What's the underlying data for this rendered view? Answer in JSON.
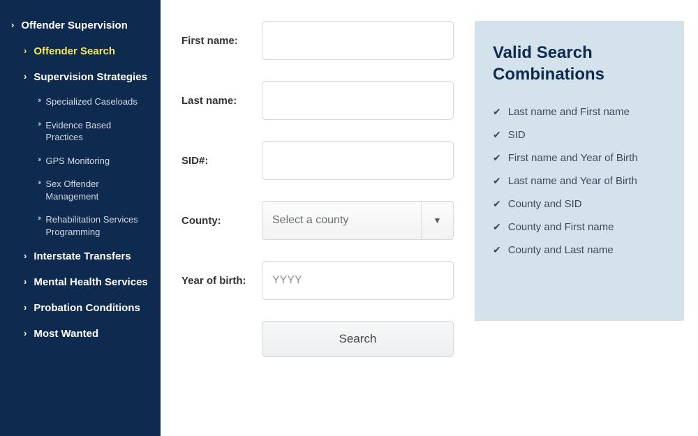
{
  "sidebar": {
    "items": [
      {
        "label": "Offender Supervision",
        "level": 0,
        "active": false
      },
      {
        "label": "Offender Search",
        "level": 1,
        "active": true
      },
      {
        "label": "Supervision Strategies",
        "level": 1,
        "active": false
      },
      {
        "label": "Specialized Caseloads",
        "level": 2
      },
      {
        "label": "Evidence Based Practices",
        "level": 2
      },
      {
        "label": "GPS Monitoring",
        "level": 2
      },
      {
        "label": "Sex Offender Management",
        "level": 2
      },
      {
        "label": "Rehabilitation Services Programming",
        "level": 2
      },
      {
        "label": "Interstate Transfers",
        "level": 1,
        "active": false
      },
      {
        "label": "Mental Health Services",
        "level": 1,
        "active": false
      },
      {
        "label": "Probation Conditions",
        "level": 1,
        "active": false
      },
      {
        "label": "Most Wanted",
        "level": 1,
        "active": false
      }
    ]
  },
  "form": {
    "first_name_label": "First name:",
    "last_name_label": "Last name:",
    "sid_label": "SID#:",
    "county_label": "County:",
    "county_placeholder": "Select a county",
    "yob_label": "Year of birth:",
    "yob_placeholder": "YYYY",
    "search_button": "Search"
  },
  "info": {
    "title": "Valid Search Combinations",
    "combos": [
      "Last name and First name",
      "SID",
      "First name and Year of Birth",
      "Last name and Year of Birth",
      "County and SID",
      "County and First name",
      "County and Last name"
    ]
  }
}
